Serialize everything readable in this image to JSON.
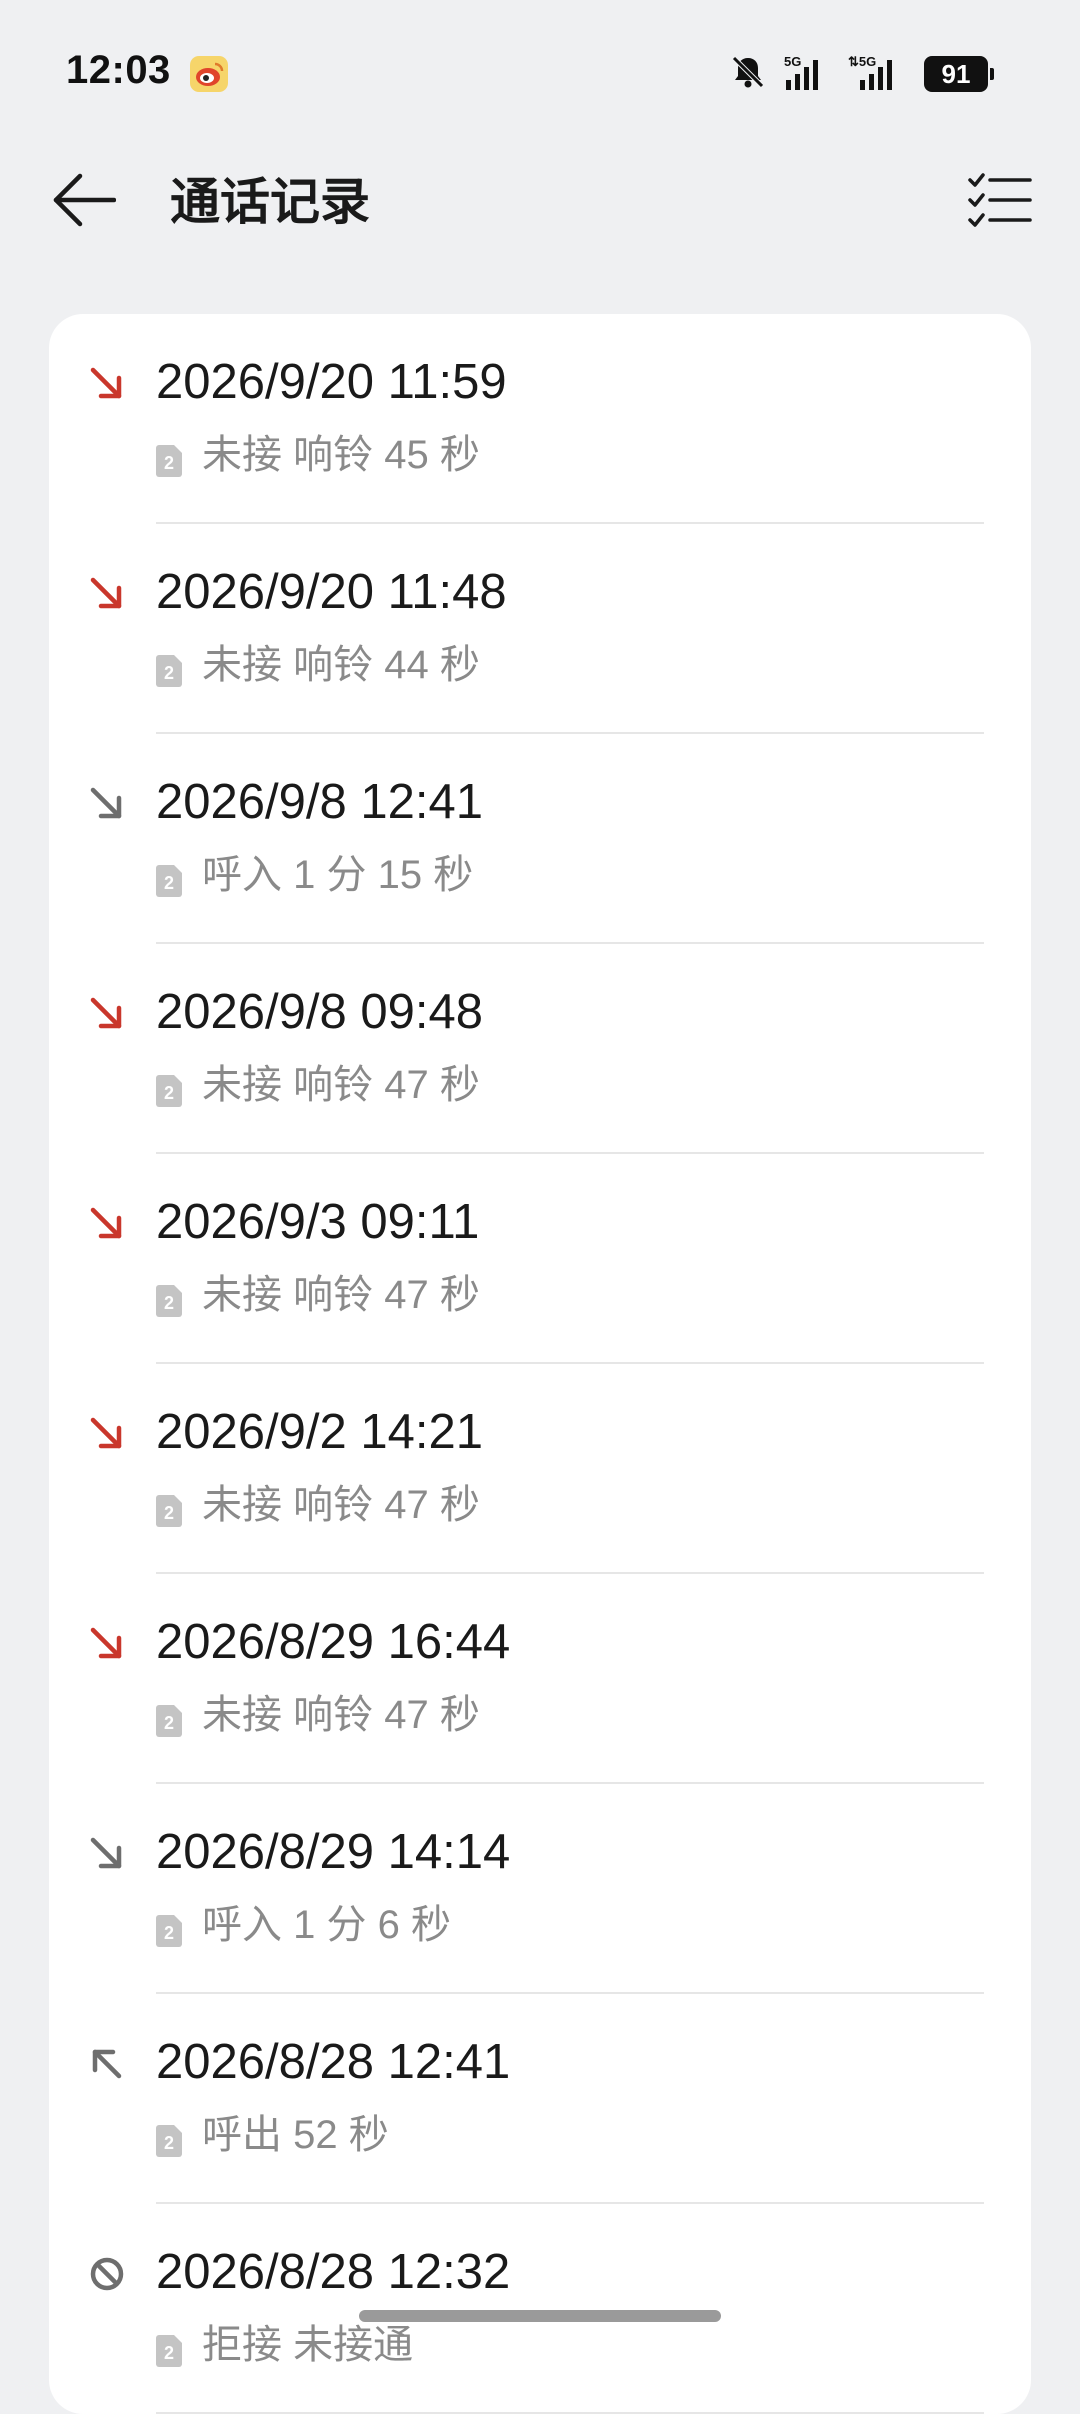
{
  "status_bar": {
    "time": "12:03",
    "notification_icon": "weibo-icon",
    "icons": [
      "bell-muted-icon",
      "signal-5g-icon",
      "signal-5g-data-icon"
    ],
    "battery": "91"
  },
  "header": {
    "title": "通话记录",
    "back_icon": "arrow-left-icon",
    "select_icon": "checklist-icon"
  },
  "colors": {
    "missed": "#c9372c",
    "normal": "#6e6e6e",
    "background": "#eff0f2",
    "card": "#ffffff"
  },
  "calls": [
    {
      "type": "missed",
      "icon": "missed-call-icon",
      "time": "2026/9/20 11:59",
      "sim": "2",
      "detail": "未接  响铃 45 秒"
    },
    {
      "type": "missed",
      "icon": "missed-call-icon",
      "time": "2026/9/20 11:48",
      "sim": "2",
      "detail": "未接  响铃 44 秒"
    },
    {
      "type": "incoming",
      "icon": "incoming-call-icon",
      "time": "2026/9/8 12:41",
      "sim": "2",
      "detail": "呼入  1 分 15 秒"
    },
    {
      "type": "missed",
      "icon": "missed-call-icon",
      "time": "2026/9/8 09:48",
      "sim": "2",
      "detail": "未接  响铃 47 秒"
    },
    {
      "type": "missed",
      "icon": "missed-call-icon",
      "time": "2026/9/3 09:11",
      "sim": "2",
      "detail": "未接  响铃 47 秒"
    },
    {
      "type": "missed",
      "icon": "missed-call-icon",
      "time": "2026/9/2 14:21",
      "sim": "2",
      "detail": "未接  响铃 47 秒"
    },
    {
      "type": "missed",
      "icon": "missed-call-icon",
      "time": "2026/8/29 16:44",
      "sim": "2",
      "detail": "未接  响铃 47 秒"
    },
    {
      "type": "incoming",
      "icon": "incoming-call-icon",
      "time": "2026/8/29 14:14",
      "sim": "2",
      "detail": "呼入  1 分 6 秒"
    },
    {
      "type": "outgoing",
      "icon": "outgoing-call-icon",
      "time": "2026/8/28 12:41",
      "sim": "2",
      "detail": "呼出  52 秒"
    },
    {
      "type": "rejected",
      "icon": "blocked-call-icon",
      "time": "2026/8/28 12:32",
      "sim": "2",
      "detail": "拒接 未接通"
    }
  ]
}
